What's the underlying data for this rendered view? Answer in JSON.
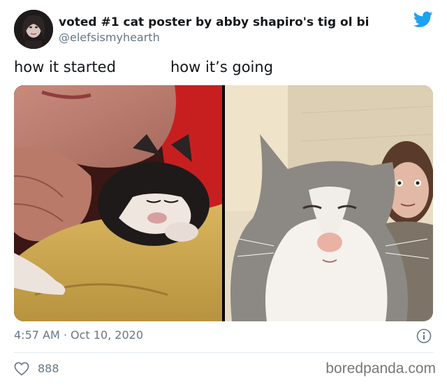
{
  "tweet": {
    "display_name": "voted #1 cat poster by abby shapiro's tig ol bi",
    "handle": "@elefsismyhearth",
    "caption_left": "how it started",
    "caption_right": "how it’s going",
    "timestamp": "4:57 AM · Oct 10, 2020",
    "like_count": "888"
  },
  "icons": {
    "brand": "twitter-bird-icon",
    "info": "info-icon",
    "like": "heart-icon"
  },
  "media": {
    "left_image": "kitten on person's shoulder",
    "right_image": "grown cat selfie with woman"
  },
  "watermark": "boredpanda.com",
  "colors": {
    "twitter_blue": "#1da1f2",
    "secondary_text": "#657786"
  }
}
